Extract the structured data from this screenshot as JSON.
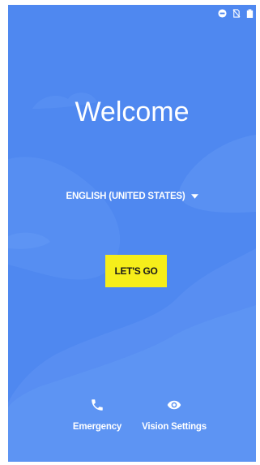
{
  "welcome": {
    "title": "Welcome",
    "language_label": "ENGLISH (UNITED STATES)",
    "start_button_label": "LET'S GO"
  },
  "bottom_actions": {
    "emergency_label": "Emergency",
    "vision_settings_label": "Vision Settings"
  },
  "status_bar": {
    "icons": [
      "do-not-disturb-icon",
      "no-sim-icon",
      "battery-icon"
    ]
  },
  "colors": {
    "background": "#4f88f0",
    "button": "#f6ee1a",
    "text": "#ffffff"
  }
}
